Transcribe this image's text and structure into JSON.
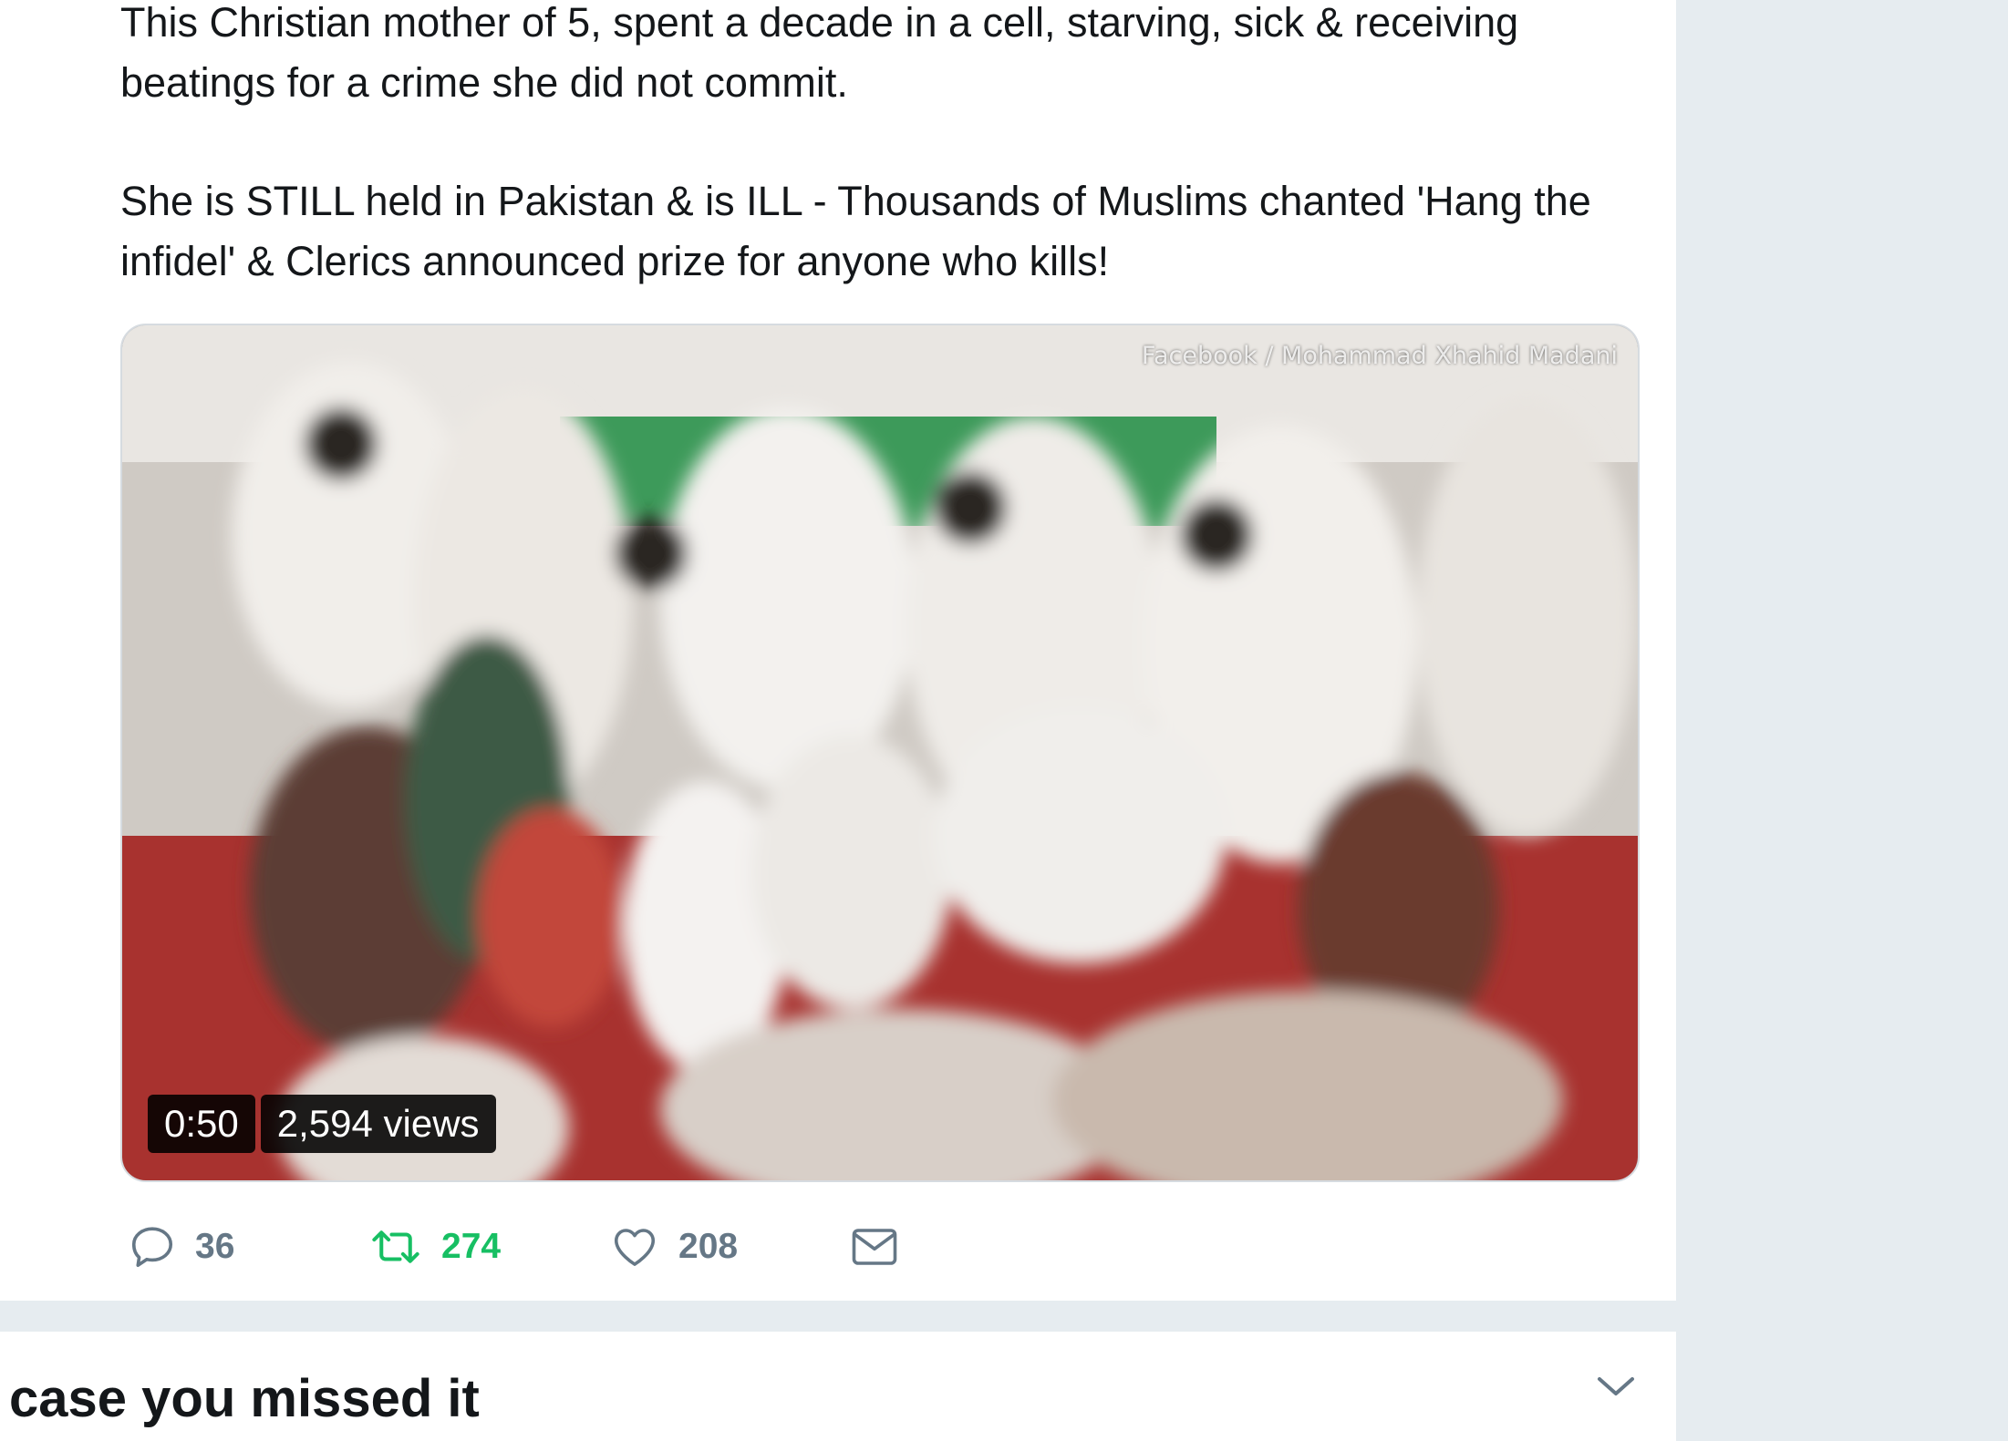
{
  "tweet": {
    "text_paragraphs": [
      [
        "This Christian mother of 5, spent a decade in a cell, starving, sick & receiving",
        "beatings for a crime she did not commit."
      ],
      [
        "She is STILL held in Pakistan & is ILL - Thousands of Muslims chanted 'Hang the",
        "infidel' & Clerics announced prize for anyone who kills!"
      ]
    ],
    "video": {
      "watermark": "Facebook / Mohammad Xhahid Madani",
      "duration": "0:50",
      "views": "2,594 views"
    },
    "actions": {
      "replies": {
        "icon": "reply-icon",
        "count": "36"
      },
      "retweets": {
        "icon": "retweet-icon",
        "count": "274",
        "color": "#17bf63"
      },
      "likes": {
        "icon": "heart-icon",
        "count": "208"
      },
      "message": {
        "icon": "envelope-icon"
      }
    }
  },
  "section": {
    "title": "case you missed it",
    "toggle_icon": "chevron-down-icon"
  },
  "colors": {
    "background": "#e6ecf0",
    "card": "#ffffff",
    "text": "#14171a",
    "muted": "#657786",
    "retweet_green": "#17bf63"
  }
}
